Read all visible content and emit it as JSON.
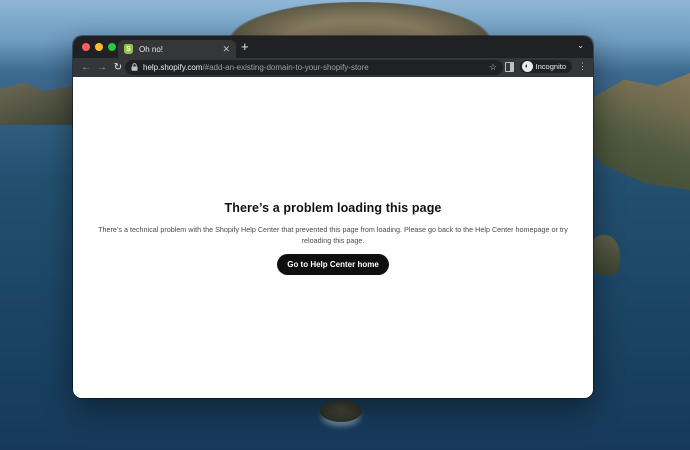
{
  "browser": {
    "tab_title": "Oh no!",
    "tab_close": "✕",
    "new_tab": "+",
    "tab_menu": "⌄",
    "url_host": "help.shopify.com",
    "url_path": "/#add-an-existing-domain-to-your-shopify-store",
    "incognito_label": "Incognito"
  },
  "icons": {
    "back": "←",
    "forward": "→",
    "reload": "↻",
    "lock": "🔒",
    "star": "☆",
    "kebab": "⋮",
    "favicon": "S",
    "incognito": "◐"
  },
  "page": {
    "heading": "There’s a problem loading this page",
    "body": "There’s a technical problem with the Shopify Help Center that prevented this page from loading. Please go back to the Help Center homepage or try reloading this page.",
    "cta_label": "Go to Help Center home"
  },
  "colors": {
    "chrome_dark": "#202124",
    "chrome_toolbar": "#35363a",
    "cta_background": "#0f0f0f",
    "shopify_green": "#95bf47"
  }
}
